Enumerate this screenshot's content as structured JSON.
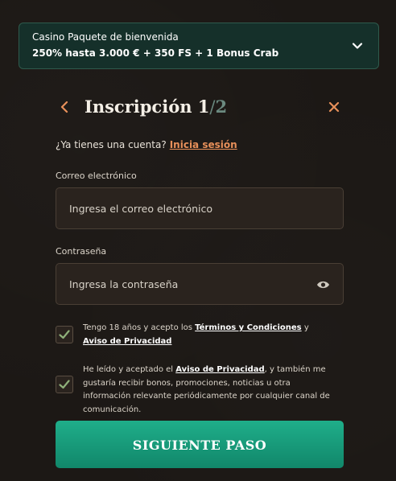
{
  "bonus": {
    "line1": "Casino Paquete de bienvenida",
    "line2": "250% hasta 3.000 € + 350 FS + 1 Bonus Crab"
  },
  "header": {
    "title": "Inscripción",
    "step_current": "1",
    "separator": "/",
    "step_total": "2"
  },
  "login": {
    "question": "¿Ya tienes una cuenta?",
    "link": "Inicia sesión"
  },
  "email": {
    "label": "Correo electrónico",
    "placeholder": "Ingresa el correo electrónico",
    "value": ""
  },
  "password": {
    "label": "Contraseña",
    "placeholder": "Ingresa la contraseña",
    "value": ""
  },
  "checks": [
    {
      "checked": true,
      "pre": "Tengo 18 años y acepto los ",
      "link1": "Términos y Condiciones",
      "mid": " y ",
      "link2": "Aviso de Privacidad"
    },
    {
      "checked": true,
      "pre": "He leído y aceptado el ",
      "link1": "Aviso de Privacidad",
      "post": ", y también me gustaría recibir bonos, promociones, noticias u otra información relevante periódicamente por cualquier canal de comunicación."
    }
  ],
  "cta": {
    "label": "SIGUIENTE PASO"
  },
  "colors": {
    "accent_orange": "#e8905a",
    "accent_green": "#1fae8a",
    "bonus_bg": "#15302a",
    "checkmark": "#8fb07a"
  },
  "icons": {
    "bonus_toggle": "chevron-down-icon",
    "back": "chevron-left-icon",
    "close": "close-icon",
    "password_toggle": "eye-icon",
    "check": "checkmark-icon"
  }
}
